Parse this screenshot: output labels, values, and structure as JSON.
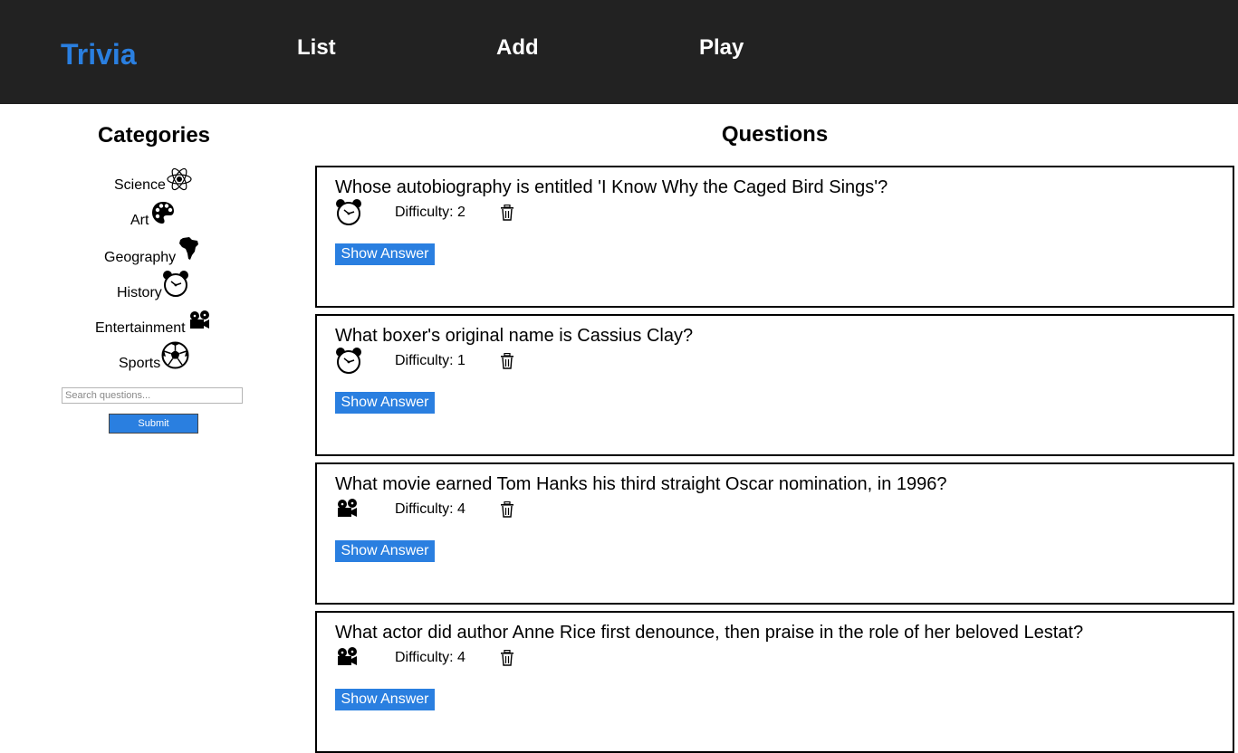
{
  "header": {
    "brand": "Trivia",
    "nav": [
      "List",
      "Add",
      "Play"
    ],
    "brand_color": "#2a7fe0",
    "bg_color": "#222222"
  },
  "sidebar": {
    "title": "Categories",
    "categories": [
      {
        "label": "Science",
        "icon": "atom-icon"
      },
      {
        "label": "Art",
        "icon": "palette-icon"
      },
      {
        "label": "Geography",
        "icon": "africa-icon"
      },
      {
        "label": "History",
        "icon": "alarm-clock-icon"
      },
      {
        "label": "Entertainment",
        "icon": "film-projector-icon"
      },
      {
        "label": "Sports",
        "icon": "soccer-ball-icon"
      }
    ],
    "search_placeholder": "Search questions...",
    "submit_label": "Submit"
  },
  "main": {
    "title": "Questions",
    "questions": [
      {
        "text": "Whose autobiography is entitled 'I Know Why the Caged Bird Sings'?",
        "category_icon": "alarm-clock-icon",
        "difficulty": "Difficulty: 2",
        "show_answer": "Show Answer"
      },
      {
        "text": "What boxer's original name is Cassius Clay?",
        "category_icon": "alarm-clock-icon",
        "difficulty": "Difficulty: 1",
        "show_answer": "Show Answer"
      },
      {
        "text": "What movie earned Tom Hanks his third straight Oscar nomination, in 1996?",
        "category_icon": "film-projector-icon",
        "difficulty": "Difficulty: 4",
        "show_answer": "Show Answer"
      },
      {
        "text": "What actor did author Anne Rice first denounce, then praise in the role of her beloved Lestat?",
        "category_icon": "film-projector-icon",
        "difficulty": "Difficulty: 4",
        "show_answer": "Show Answer"
      }
    ]
  }
}
